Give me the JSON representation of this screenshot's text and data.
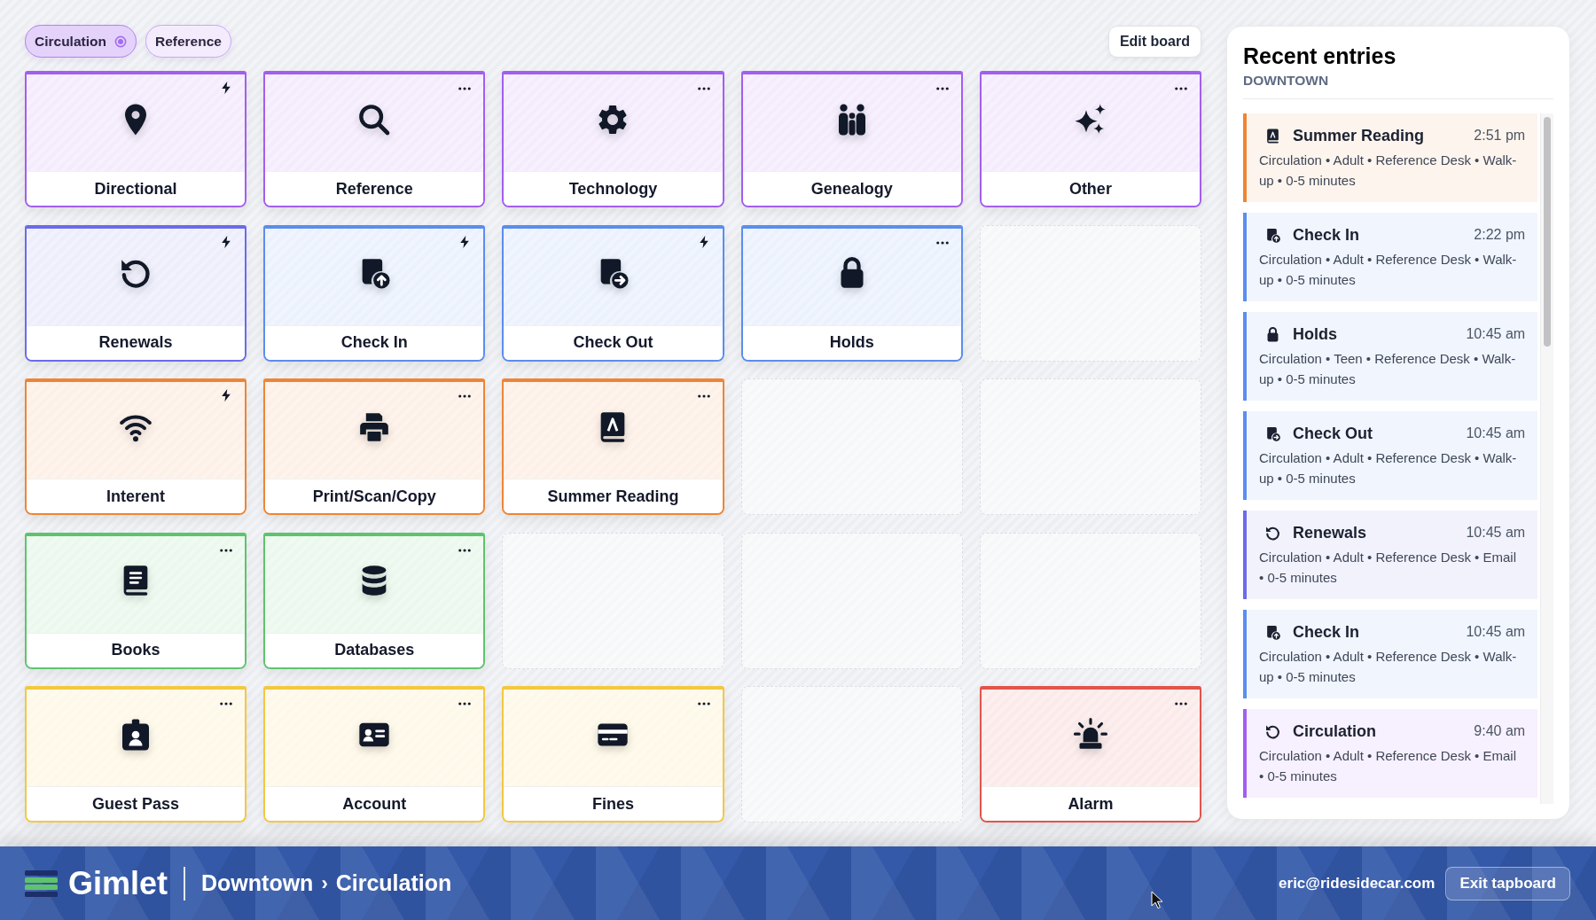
{
  "board_tabs": [
    {
      "label": "Circulation",
      "selected": true
    },
    {
      "label": "Reference",
      "selected": false
    }
  ],
  "edit_button": {
    "label": "Edit board"
  },
  "tiles": [
    {
      "kind": "category",
      "label": "Directional",
      "color": "#a35ef0",
      "quick": true
    },
    {
      "kind": "category",
      "label": "Reference",
      "color": "#a35ef0",
      "quick": false
    },
    {
      "kind": "category",
      "label": "Technology",
      "color": "#a35ef0",
      "quick": false
    },
    {
      "kind": "category",
      "label": "Genealogy",
      "color": "#a35ef0",
      "quick": false
    },
    {
      "kind": "category",
      "label": "Other",
      "color": "#a35ef0",
      "quick": false
    },
    {
      "kind": "category",
      "label": "Renewals",
      "color": "#6b6bea",
      "quick": true
    },
    {
      "kind": "category",
      "label": "Check In",
      "color": "#5b8def",
      "quick": true
    },
    {
      "kind": "category",
      "label": "Check Out",
      "color": "#5b8def",
      "quick": true
    },
    {
      "kind": "category",
      "label": "Holds",
      "color": "#5b8def",
      "quick": false
    },
    {
      "kind": "empty"
    },
    {
      "kind": "category",
      "label": "Interent",
      "color": "#ee8535",
      "quick": true
    },
    {
      "kind": "category",
      "label": "Print/Scan/Copy",
      "color": "#ee8535",
      "quick": false
    },
    {
      "kind": "category",
      "label": "Summer Reading",
      "color": "#ee8535",
      "quick": false
    },
    {
      "kind": "empty"
    },
    {
      "kind": "empty"
    },
    {
      "kind": "category",
      "label": "Books",
      "color": "#5ec46c",
      "quick": false
    },
    {
      "kind": "category",
      "label": "Databases",
      "color": "#5ec46c",
      "quick": false
    },
    {
      "kind": "empty"
    },
    {
      "kind": "empty"
    },
    {
      "kind": "empty"
    },
    {
      "kind": "category",
      "label": "Guest Pass",
      "color": "#f3c840",
      "quick": false
    },
    {
      "kind": "category",
      "label": "Account",
      "color": "#f3c840",
      "quick": false
    },
    {
      "kind": "category",
      "label": "Fines",
      "color": "#f3c840",
      "quick": false
    },
    {
      "kind": "empty"
    },
    {
      "kind": "category",
      "label": "Alarm",
      "color": "#e2544b",
      "quick": false
    }
  ],
  "recent_entries": {
    "title": "Recent entries",
    "location": "DOWNTOWN",
    "entries": [
      {
        "title": "Summer Reading",
        "time": "2:51 pm",
        "details": "Circulation • Adult • Reference Desk • Walk-up • 0-5 minutes",
        "color": "#ee8535"
      },
      {
        "title": "Check In",
        "time": "2:22 pm",
        "details": "Circulation • Adult • Reference Desk • Walk-up • 0-5 minutes",
        "color": "#5b8def"
      },
      {
        "title": "Holds",
        "time": "10:45 am",
        "details": "Circulation • Teen • Reference Desk • Walk-up • 0-5 minutes",
        "color": "#5b8def"
      },
      {
        "title": "Check Out",
        "time": "10:45 am",
        "details": "Circulation • Adult • Reference Desk • Walk-up • 0-5 minutes",
        "color": "#5b8def"
      },
      {
        "title": "Renewals",
        "time": "10:45 am",
        "details": "Circulation • Adult • Reference Desk • Email • 0-5 minutes",
        "color": "#6b6bea"
      },
      {
        "title": "Check In",
        "time": "10:45 am",
        "details": "Circulation • Adult • Reference Desk • Walk-up • 0-5 minutes",
        "color": "#5b8def"
      },
      {
        "title": "Circulation",
        "time": "9:40 am",
        "details": "Circulation • Adult • Reference Desk • Email • 0-5 minutes",
        "color": "#a35ef0"
      }
    ]
  },
  "footer": {
    "brand": "Gimlet",
    "breadcrumb": [
      "Downtown",
      "Circulation"
    ],
    "separator": "›",
    "user_email": "eric@ridesidecar.com",
    "exit_button": "Exit tapboard"
  }
}
